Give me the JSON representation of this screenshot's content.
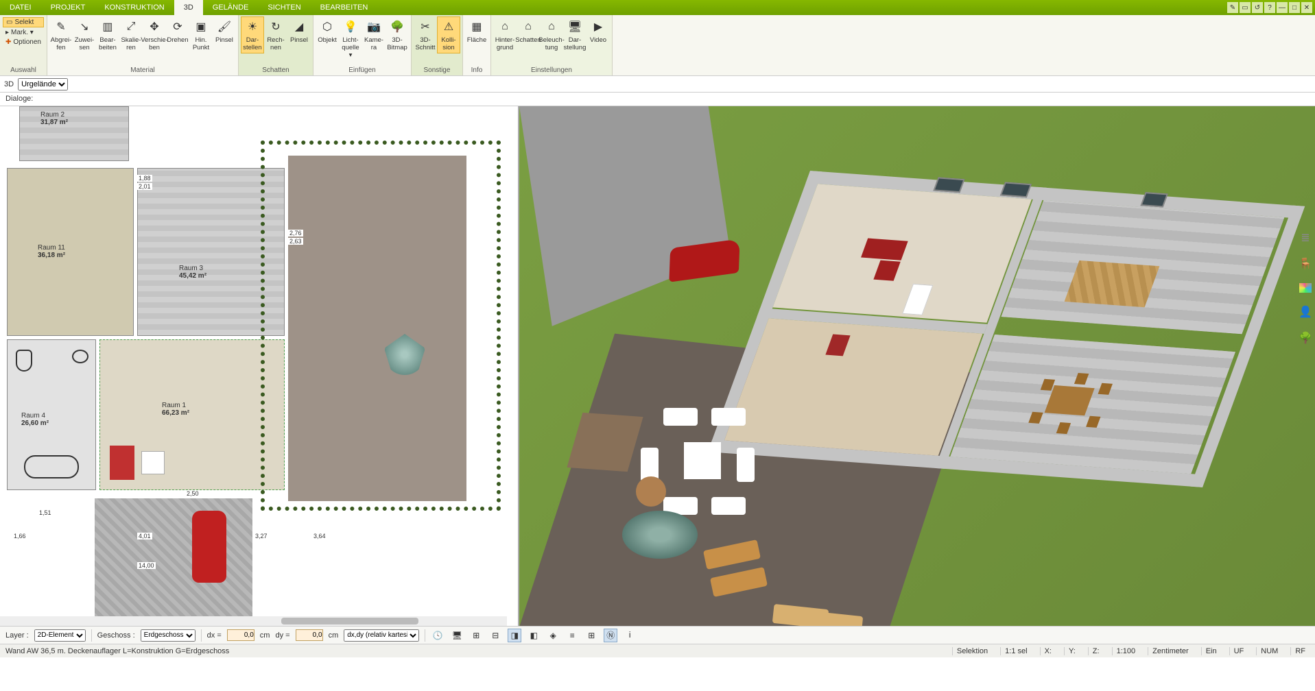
{
  "menubar": {
    "tabs": [
      "DATEI",
      "PROJEKT",
      "KONSTRUKTION",
      "3D",
      "GELÄNDE",
      "SICHTEN",
      "BEARBEITEN"
    ],
    "active": 3
  },
  "ribbon": {
    "groups": [
      {
        "id": "auswahl",
        "title": "Auswahl",
        "small": [
          "Selekt",
          "Mark. ▾",
          "Optionen"
        ]
      },
      {
        "id": "material",
        "title": "Material",
        "buttons": [
          {
            "id": "abgreifen",
            "icon": "✎",
            "label": "Abgrei-\nfen"
          },
          {
            "id": "zuweisen",
            "icon": "↘",
            "label": "Zuwei-\nsen"
          },
          {
            "id": "bearbeiten",
            "icon": "▥",
            "label": "Bear-\nbeiten"
          },
          {
            "id": "skalieren",
            "icon": "⤢",
            "label": "Skalie-\nren"
          },
          {
            "id": "verschieben",
            "icon": "✥",
            "label": "Verschie-\nben"
          },
          {
            "id": "drehen",
            "icon": "⟳",
            "label": "Drehen"
          },
          {
            "id": "hinpunkt",
            "icon": "▣",
            "label": "Hin.\nPunkt"
          },
          {
            "id": "pinsel",
            "icon": "🖌",
            "label": "Pinsel"
          }
        ]
      },
      {
        "id": "schatten",
        "title": "Schatten",
        "buttons": [
          {
            "id": "darstellen",
            "icon": "☀",
            "label": "Dar-\nstellen",
            "sel": true
          },
          {
            "id": "rechnen",
            "icon": "↻",
            "label": "Rech-\nnen"
          },
          {
            "id": "pinsel2",
            "icon": "◢",
            "label": "Pinsel"
          }
        ]
      },
      {
        "id": "einfuegen",
        "title": "Einfügen",
        "buttons": [
          {
            "id": "objekt",
            "icon": "⬡",
            "label": "Objekt"
          },
          {
            "id": "licht",
            "icon": "💡",
            "label": "Licht-\nquelle ▾"
          },
          {
            "id": "kamera",
            "icon": "📷",
            "label": "Kame-\nra"
          },
          {
            "id": "bmp3d",
            "icon": "🌳",
            "label": "3D-\nBitmap"
          }
        ]
      },
      {
        "id": "sonstige",
        "title": "Sonstige",
        "buttons": [
          {
            "id": "schnitt3d",
            "icon": "✂",
            "label": "3D-\nSchnitt"
          },
          {
            "id": "kollision",
            "icon": "⚠",
            "label": "Kolli-\nsion",
            "sel": true
          }
        ]
      },
      {
        "id": "info",
        "title": "Info",
        "buttons": [
          {
            "id": "flaeche",
            "icon": "▦",
            "label": "Fläche"
          }
        ]
      },
      {
        "id": "einstellungen",
        "title": "Einstellungen",
        "buttons": [
          {
            "id": "hintergrund",
            "icon": "⌂",
            "label": "Hinter-\ngrund"
          },
          {
            "id": "schatten2",
            "icon": "⌂",
            "label": "Schatten"
          },
          {
            "id": "beleuchtung",
            "icon": "⌂",
            "label": "Beleuch-\ntung"
          },
          {
            "id": "darstellung",
            "icon": "🖥",
            "label": "Dar-\nstellung"
          },
          {
            "id": "video",
            "icon": "▶",
            "label": "Video"
          }
        ]
      }
    ]
  },
  "subbar": {
    "viewlbl": "3D",
    "combo": "Urgelände"
  },
  "dialoge": {
    "label": "Dialoge:"
  },
  "floorplan": {
    "rooms": [
      {
        "name": "Raum 2",
        "area": "31,87 m²"
      },
      {
        "name": "Raum 11",
        "area": "36,18 m²"
      },
      {
        "name": "Raum 3",
        "area": "45,42 m²"
      },
      {
        "name": "Raum 4",
        "area": "26,60 m²"
      },
      {
        "name": "Raum 1",
        "area": "66,23 m²"
      }
    ],
    "dims": [
      "1,88",
      "2,01",
      "2,76",
      "2,63",
      "1,51",
      "1,66",
      "4,01",
      "3,27",
      "3,64",
      "14,00",
      "2,50"
    ]
  },
  "sidepal": [
    "layers",
    "chair",
    "colors",
    "person",
    "tree"
  ],
  "bottom": {
    "layer_lbl": "Layer :",
    "layer_val": "2D-Element",
    "geschoss_lbl": "Geschoss :",
    "geschoss_val": "Erdgeschoss",
    "dx_lbl": "dx =",
    "dx_val": "0,0",
    "dx_unit": "cm",
    "dy_lbl": "dy =",
    "dy_val": "0,0",
    "dy_unit": "cm",
    "mode": "dx,dy (relativ kartesisch)"
  },
  "status": {
    "left": "Wand AW 36,5 m. Deckenauflager L=Konstruktion G=Erdgeschoss",
    "selektion": "Selektion",
    "sel": "1:1 sel",
    "x": "X:",
    "y": "Y:",
    "z": "Z:",
    "scale": "1:100",
    "units": "Zentimeter",
    "ein": "Ein",
    "uf": "UF",
    "num": "NUM",
    "rf": "RF"
  }
}
